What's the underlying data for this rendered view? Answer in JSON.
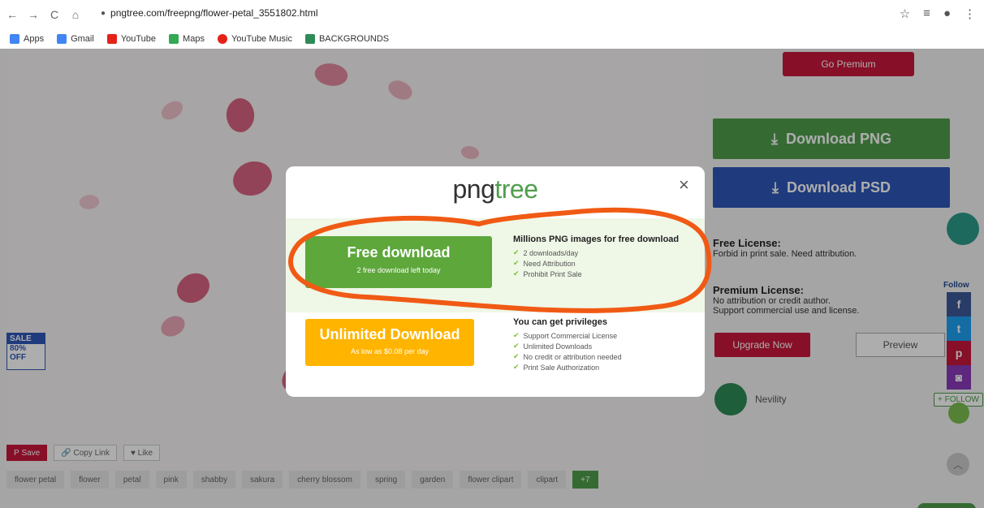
{
  "browser": {
    "url": "pngtree.com/freepng/flower-petal_3551802.html",
    "bookmarks": [
      {
        "label": "Apps",
        "icon": "apps-grid-icon",
        "color": "#4285f4"
      },
      {
        "label": "Gmail",
        "icon": "google-icon",
        "color": "#4285f4"
      },
      {
        "label": "YouTube",
        "icon": "youtube-icon",
        "color": "#e62117"
      },
      {
        "label": "Maps",
        "icon": "maps-pin-icon",
        "color": "#34a853"
      },
      {
        "label": "YouTube Music",
        "icon": "youtube-music-icon",
        "color": "#e62117"
      },
      {
        "label": "BACKGROUNDS",
        "icon": "bookmark-folder-icon",
        "color": "#2e8b57"
      }
    ]
  },
  "sidebar": {
    "go_premium": "Go Premium",
    "download_png": "Download PNG",
    "download_psd": "Download PSD",
    "free_license_title": "Free License:",
    "free_license_text": "Forbid in print sale. Need attribution.",
    "premium_license_title": "Premium License:",
    "premium_license_line1": "No attribution or credit author.",
    "premium_license_line2": "Support commercial use and license.",
    "upgrade_now": "Upgrade Now",
    "preview": "Preview",
    "author_name": "Nevility",
    "follow_label": "Follow",
    "follow_button": "+ FOLLOW"
  },
  "sale_badge": {
    "label": "SALE",
    "percent": "80%",
    "off": "OFF"
  },
  "actions": {
    "save": "Save",
    "copy_link": "Copy Link",
    "like": "Like"
  },
  "tags": [
    "flower petal",
    "flower",
    "petal",
    "pink",
    "shabby",
    "sakura",
    "cherry blossom",
    "spring",
    "garden",
    "flower clipart",
    "clipart",
    "+7"
  ],
  "modal": {
    "logo_png": "png",
    "logo_tree": "tree",
    "close": "×",
    "free_download": {
      "title": "Free download",
      "subtitle": "2 free download left today"
    },
    "free_features": {
      "heading": "Millions PNG images for free download",
      "items": [
        "2 downloads/day",
        "Need Attribution",
        "Prohibit Print Sale"
      ]
    },
    "unlimited_download": {
      "title": "Unlimited Download",
      "subtitle": "As low as $0.08 per day"
    },
    "privileges": {
      "heading": "You can get privileges",
      "items": [
        "Support Commercial License",
        "Unlimited Downloads",
        "No credit or attribution needed",
        "Print Sale Authorization"
      ]
    }
  },
  "colors": {
    "accent_green": "#5da73b",
    "accent_orange": "#ffb400",
    "annotation_orange": "#f05a14",
    "brand_red": "#c8173a",
    "brand_blue": "#2f58b8"
  }
}
